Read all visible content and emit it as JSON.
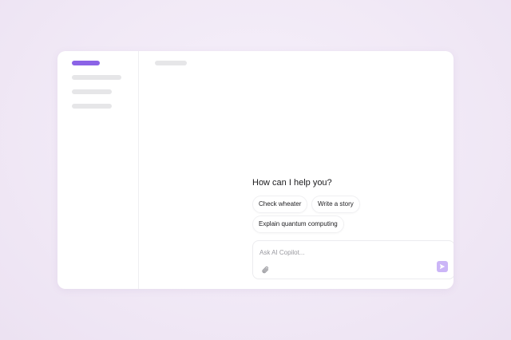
{
  "prompt": {
    "heading": "How can I help you?"
  },
  "suggestions": [
    "Check wheater",
    "Write a story",
    "Explain quantum computing"
  ],
  "composer": {
    "placeholder": "Ask AI Copilot...",
    "value": ""
  },
  "icons": {
    "attach": "paperclip-icon",
    "send": "send-icon"
  },
  "colors": {
    "accent": "#8b63e6",
    "send_button": "#cbb5f7",
    "placeholder_bar": "#e6e6e8"
  }
}
